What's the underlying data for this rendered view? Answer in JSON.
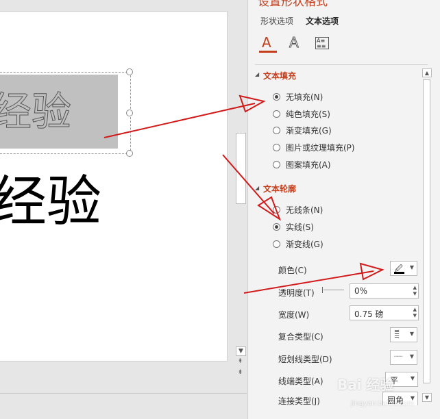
{
  "panel": {
    "title": "设置形状格式",
    "tabs": [
      {
        "label": "形状选项",
        "active": false
      },
      {
        "label": "文本选项",
        "active": true
      }
    ],
    "icons": [
      "text-fill-outline-icon",
      "text-effects-icon",
      "textbox-icon"
    ]
  },
  "slide": {
    "outline_text": "经验",
    "solid_text": "经验"
  },
  "text_fill": {
    "header": "文本填充",
    "options": [
      {
        "label": "无填充(N)",
        "selected": true
      },
      {
        "label": "纯色填充(S)",
        "selected": false
      },
      {
        "label": "渐变填充(G)",
        "selected": false
      },
      {
        "label": "图片或纹理填充(P)",
        "selected": false
      },
      {
        "label": "图案填充(A)",
        "selected": false
      }
    ]
  },
  "text_outline": {
    "header": "文本轮廓",
    "options": [
      {
        "label": "无线条(N)",
        "selected": false
      },
      {
        "label": "实线(S)",
        "selected": true
      },
      {
        "label": "渐变线(G)",
        "selected": false
      }
    ],
    "color_label": "颜色(C)",
    "transparency_label": "透明度(T)",
    "transparency_value": "0%",
    "width_label": "宽度(W)",
    "width_value": "0.75 磅",
    "compound_label": "复合类型(C)",
    "dash_label": "短划线类型(D)",
    "cap_label": "线端类型(A)",
    "cap_value": "平",
    "join_label": "连接类型(J)",
    "join_value": "圆角"
  },
  "colors": {
    "accent": "#c43e1c",
    "arrow": "#d21a1a"
  },
  "watermark": {
    "main": "Bai 经验",
    "sub": "jingyan.baidu.com"
  }
}
